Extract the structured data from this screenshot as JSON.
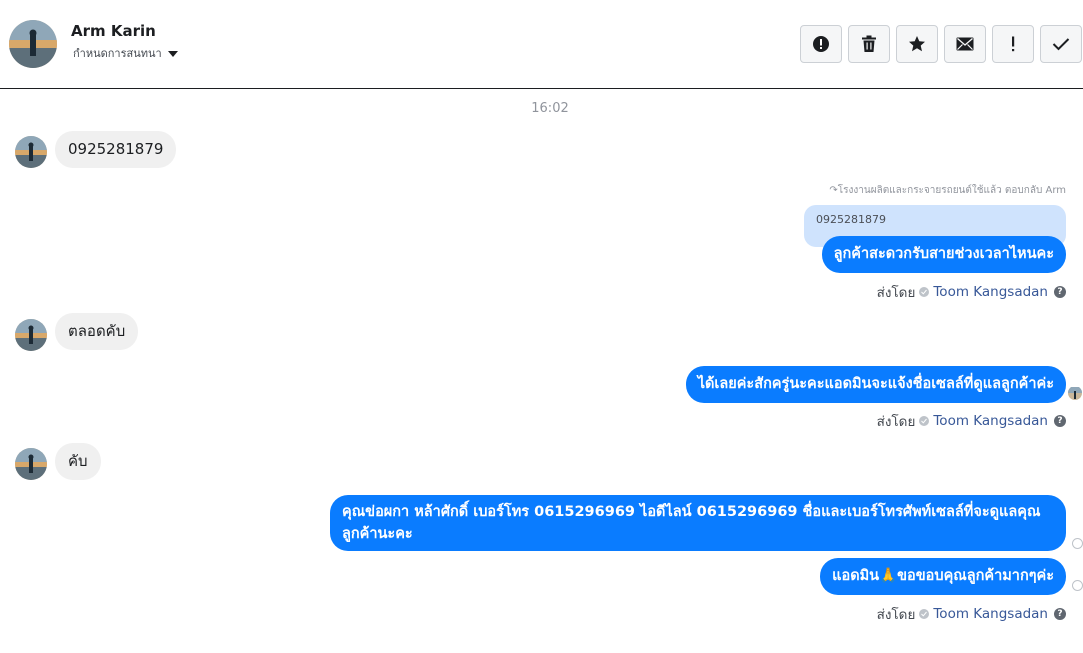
{
  "header": {
    "contact_name": "Arm Karin",
    "assign_label": "กำหนดการสนทนา",
    "toolbar": [
      {
        "icon": "alert-circle-icon",
        "name": "mark-spam-button"
      },
      {
        "icon": "trash-icon",
        "name": "delete-button"
      },
      {
        "icon": "star-icon",
        "name": "star-button"
      },
      {
        "icon": "envelope-icon",
        "name": "mark-unread-button"
      },
      {
        "icon": "exclamation-icon",
        "name": "flag-button"
      },
      {
        "icon": "check-icon",
        "name": "mark-done-button"
      }
    ]
  },
  "conversation": {
    "timestamp": "16:02",
    "messages": [
      {
        "direction": "in",
        "text": "0925281879"
      },
      {
        "direction": "out",
        "reply_note": "โรงงานผลิตและกระจายรถยนต์ใช้แล้ว ตอบกลับ Arm",
        "quoted": "0925281879",
        "text": "ลูกค้าสะดวกรับสายช่วงเวลาไหนคะ"
      },
      {
        "direction": "in",
        "text": "ตลอดคับ"
      },
      {
        "direction": "out",
        "text": "ได้เลยค่ะสักครู่นะคะแอดมินจะแจ้งชื่อเซลล์ที่ดูแลลูกค้าค่ะ"
      },
      {
        "direction": "in",
        "text": "คับ"
      },
      {
        "direction": "out",
        "text": "คุณข่อผกา หล้าศักดิ์      เบอร์โทร 0615296969  ไอดีไลน์ 0615296969 ชื่อและเบอร์โทรศัพท์เซลล์ที่จะดูแลคุณลูกค้านะคะ"
      },
      {
        "direction": "out",
        "text": "แอดมิน🙏ขอขอบคุณลูกค้ามากๆค่ะ"
      }
    ],
    "sent_by_label": "ส่งโดย",
    "sender_name": "Toom Kangsadan"
  },
  "colors": {
    "outgoing": "#0a7cff",
    "incoming": "#f0f0f0",
    "reply_quote": "#cfe3fd",
    "sender_link": "#385898"
  }
}
